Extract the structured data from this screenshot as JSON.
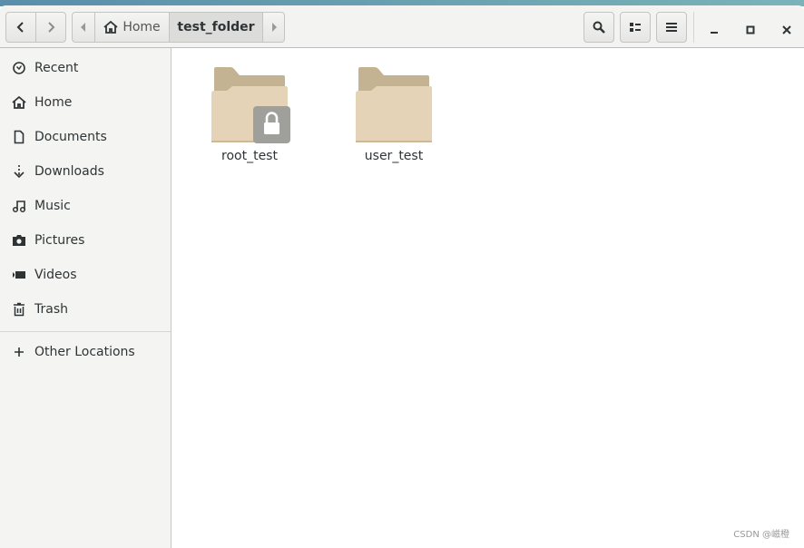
{
  "header": {
    "path": [
      {
        "label": "Home",
        "icon": "home-icon"
      },
      {
        "label": "test_folder"
      }
    ],
    "buttons": [
      "back",
      "forward",
      "search",
      "view-toggle",
      "menu",
      "minimize",
      "maximize",
      "close"
    ]
  },
  "sidebar": {
    "items": [
      {
        "label": "Recent",
        "icon": "clock-icon"
      },
      {
        "label": "Home",
        "icon": "home-icon"
      },
      {
        "label": "Documents",
        "icon": "document-icon"
      },
      {
        "label": "Downloads",
        "icon": "download-icon"
      },
      {
        "label": "Music",
        "icon": "music-icon"
      },
      {
        "label": "Pictures",
        "icon": "camera-icon"
      },
      {
        "label": "Videos",
        "icon": "video-icon"
      },
      {
        "label": "Trash",
        "icon": "trash-icon"
      }
    ],
    "other": {
      "label": "Other Locations",
      "icon": "plus-icon"
    }
  },
  "files": [
    {
      "name": "root_test",
      "locked": true
    },
    {
      "name": "user_test",
      "locked": false
    }
  ],
  "colors": {
    "folder_back": "#c3b393",
    "folder_front": "#e4d3b6",
    "lock": "#9fa09b"
  },
  "watermark": "CSDN @嵫橙"
}
